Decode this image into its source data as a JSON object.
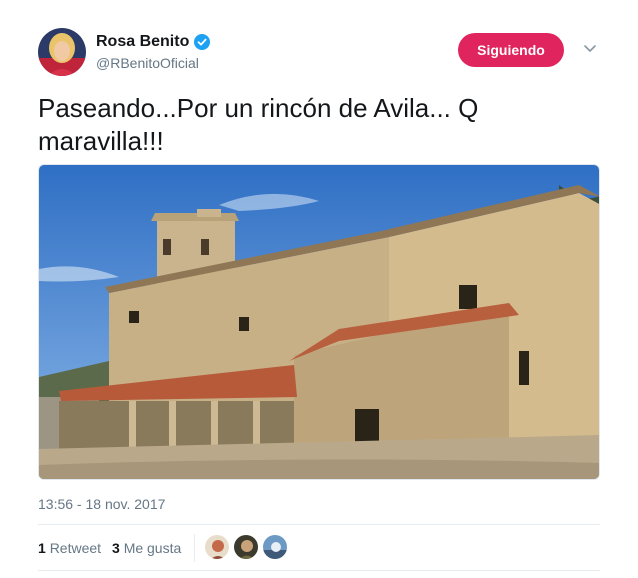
{
  "user": {
    "display_name": "Rosa Benito",
    "handle": "@RBenitoOficial",
    "verified_icon": "verified-badge-icon"
  },
  "actions": {
    "follow_label": "Siguiendo",
    "menu_icon": "chevron-down-icon"
  },
  "tweet": {
    "text": "Paseando...Por un rincón de Avila... Q maravilla!!!",
    "timestamp": "13:56 - 18 nov. 2017"
  },
  "stats": {
    "retweets_count": "1",
    "retweets_label": "Retweet",
    "likes_count": "3",
    "likes_label": "Me gusta"
  },
  "colors": {
    "follow_button": "#e0245e",
    "verified": "#1da1f2",
    "secondary_text": "#657786"
  }
}
